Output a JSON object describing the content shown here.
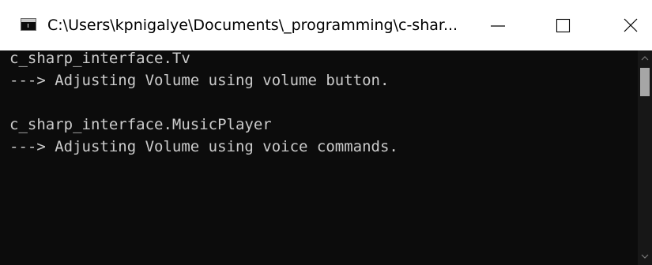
{
  "window": {
    "title": "C:\\Users\\kpnigalye\\Documents\\_programming\\c-shar...",
    "app_icon": "console-icon",
    "controls": {
      "minimize_icon": "minimize-icon",
      "maximize_icon": "maximize-icon",
      "close_icon": "close-icon"
    }
  },
  "console": {
    "lines": [
      "c_sharp_interface.Tv",
      "---> Adjusting Volume using volume button.",
      "",
      "c_sharp_interface.MusicPlayer",
      "---> Adjusting Volume using voice commands."
    ]
  },
  "colors": {
    "console_background": "#0c0c0c",
    "console_text": "#cccccc",
    "titlebar_background": "#ffffff",
    "scrollbar_thumb": "#a6a6a6"
  },
  "scrollbar": {
    "position_fraction": 0.0
  }
}
